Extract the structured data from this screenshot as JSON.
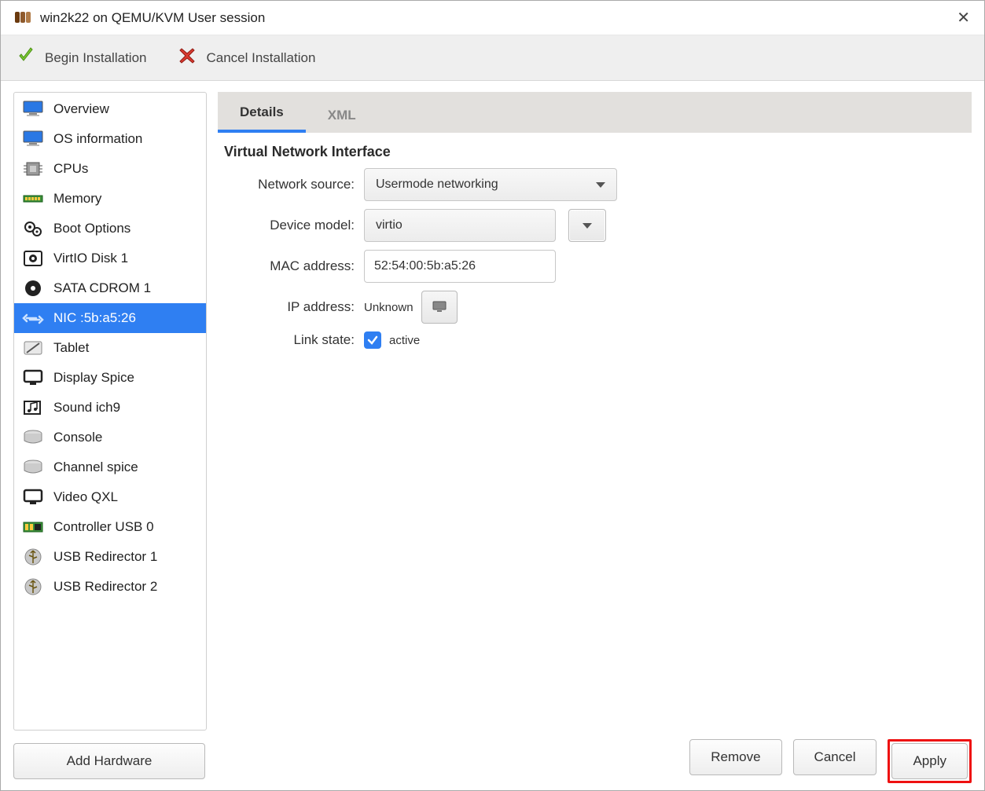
{
  "window": {
    "title": "win2k22 on QEMU/KVM User session"
  },
  "toolbar": {
    "begin": "Begin Installation",
    "cancel": "Cancel Installation"
  },
  "sidebar": {
    "items": [
      {
        "label": "Overview"
      },
      {
        "label": "OS information"
      },
      {
        "label": "CPUs"
      },
      {
        "label": "Memory"
      },
      {
        "label": "Boot Options"
      },
      {
        "label": "VirtIO Disk 1"
      },
      {
        "label": "SATA CDROM 1"
      },
      {
        "label": "NIC :5b:a5:26"
      },
      {
        "label": "Tablet"
      },
      {
        "label": "Display Spice"
      },
      {
        "label": "Sound ich9"
      },
      {
        "label": "Console"
      },
      {
        "label": "Channel spice"
      },
      {
        "label": "Video QXL"
      },
      {
        "label": "Controller USB 0"
      },
      {
        "label": "USB Redirector 1"
      },
      {
        "label": "USB Redirector 2"
      }
    ],
    "selected_index": 7
  },
  "tabs": {
    "details": "Details",
    "xml": "XML",
    "active": "details"
  },
  "panel": {
    "title": "Virtual Network Interface",
    "labels": {
      "source": "Network source:",
      "model": "Device model:",
      "mac": "MAC address:",
      "ip": "IP address:",
      "link": "Link state:"
    },
    "values": {
      "source": "Usermode networking",
      "model": "virtio",
      "mac": "52:54:00:5b:a5:26",
      "ip": "Unknown",
      "link_active_label": "active",
      "link_active": true
    }
  },
  "buttons": {
    "add_hardware": "Add Hardware",
    "remove": "Remove",
    "cancel": "Cancel",
    "apply": "Apply"
  }
}
